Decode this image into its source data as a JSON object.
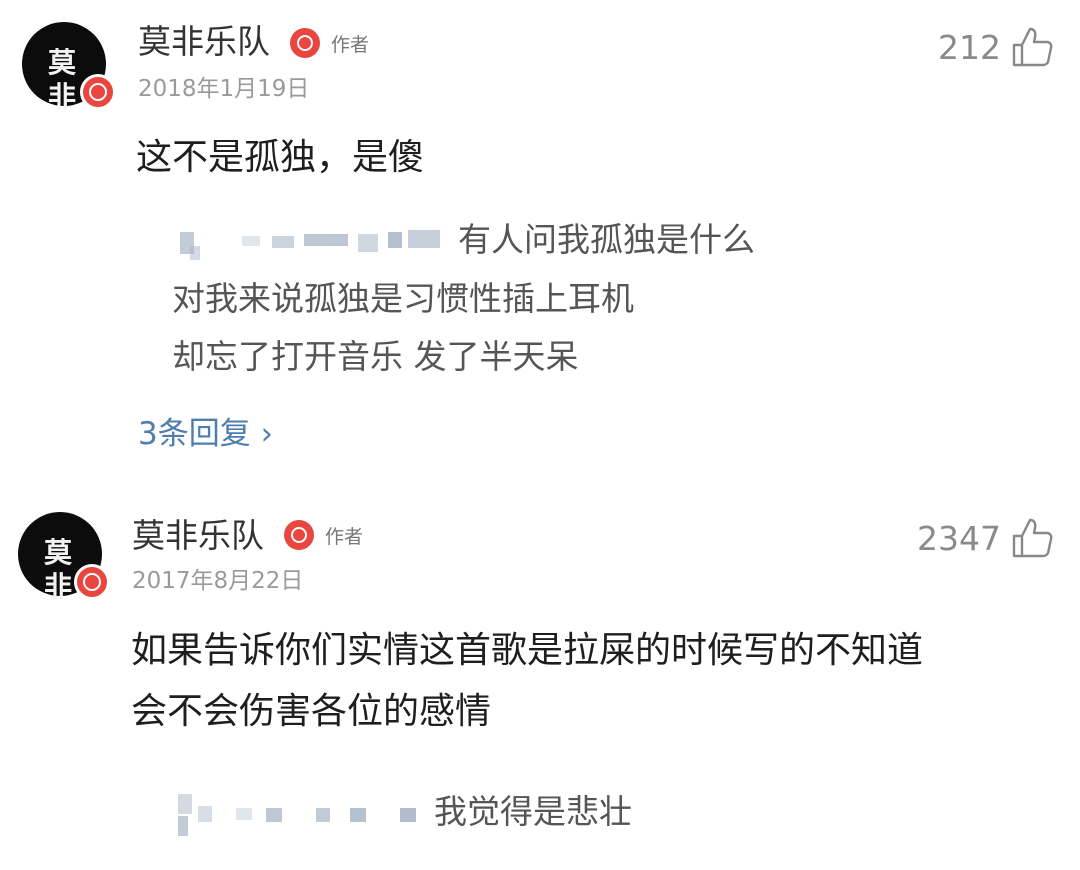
{
  "comments": [
    {
      "avatar_text": "莫 非",
      "username": "莫非乐队",
      "author_tag": "作者",
      "date": "2018年1月19日",
      "likes": "212",
      "content": "这不是孤独，是傻",
      "reply_lines": [
        "有人问我孤独是什么",
        "对我来说孤独是习惯性插上耳机",
        "却忘了打开音乐 发了半天呆"
      ],
      "replies_link": "3条回复 ›"
    },
    {
      "avatar_text": "莫 非",
      "username": "莫非乐队",
      "author_tag": "作者",
      "date": "2017年8月22日",
      "likes": "2347",
      "content_lines": [
        "如果告诉你们实情这首歌是拉屎的时候写的不知道",
        "会不会伤害各位的感情"
      ],
      "reply_lines": [
        "我觉得是悲壮"
      ]
    }
  ],
  "colors": {
    "badge": "#e8463e",
    "link": "#507daf",
    "meta": "#9a9a9a"
  },
  "icons": {
    "verified": "netease-verified-icon",
    "like": "thumbs-up-icon"
  }
}
